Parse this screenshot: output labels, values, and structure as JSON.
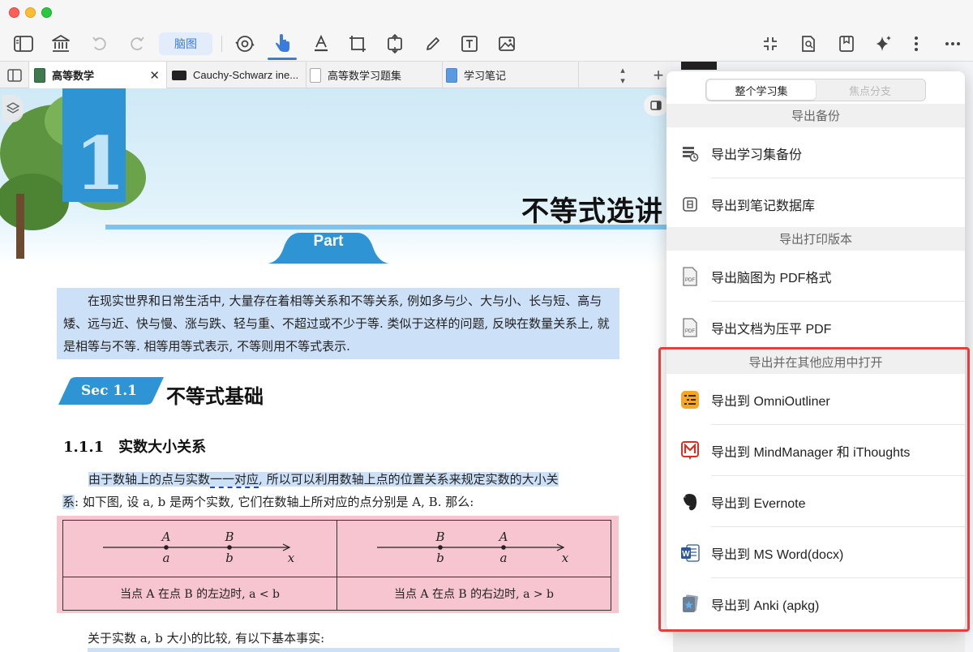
{
  "toolbar": {
    "mindmap_label": "脑图"
  },
  "tabs": [
    {
      "label": "高等数学",
      "active": true
    },
    {
      "label": "Cauchy-Schwarz ine..."
    },
    {
      "label": "高等数学习题集"
    },
    {
      "label": "学习笔记"
    }
  ],
  "document": {
    "chapter_number": "1",
    "chapter_title": "不等式选讲",
    "part_label": "Part",
    "intro_paragraph": "在现实世界和日常生活中, 大量存在着相等关系和不等关系, 例如多与少、大与小、长与短、高与矮、远与近、快与慢、涨与跌、轻与重、不超过或不少于等. 类似于这样的问题, 反映在数量关系上, 就是相等与不等. 相等用等式表示, 不等则用不等式表示.",
    "section_badge": "Sec 1.1",
    "section_title": "不等式基础",
    "subsection_title": "1.1.1　实数大小关系",
    "p2_part1": "由于数轴上的点与实数",
    "p2_dashed": "一一对应",
    "p2_part2": ", 所以可以利用数轴上点的位置关系来规定实数的大小关",
    "p2_line2_hl": "系",
    "p2_line2_rest": ": 如下图, 设 a, b 是两个实数, 它们在数轴上所对应的点分别是 A, B. 那么:",
    "figure": {
      "left": {
        "upper": [
          "A",
          "B"
        ],
        "lower": [
          "a",
          "b"
        ],
        "axis": "x",
        "caption": "当点 A 在点 B 的左边时, a < b"
      },
      "right": {
        "upper": [
          "B",
          "A"
        ],
        "lower": [
          "b",
          "a"
        ],
        "axis": "x",
        "caption": "当点 A 在点 B 的右边时, a > b"
      }
    },
    "p3": "关于实数 a, b 大小的比较, 有以下基本事实:"
  },
  "export_popover": {
    "segment": {
      "selected": "整个学习集",
      "unselected": "焦点分支"
    },
    "sections": [
      {
        "title": "导出备份",
        "items": [
          {
            "label": "导出学习集备份",
            "icon": "backup-icon"
          },
          {
            "label": "导出到笔记数据库",
            "icon": "database-icon"
          }
        ]
      },
      {
        "title": "导出打印版本",
        "items": [
          {
            "label": "导出脑图为 PDF格式",
            "icon": "pdf-icon"
          },
          {
            "label": "导出文档为压平 PDF",
            "icon": "pdf-icon"
          }
        ]
      },
      {
        "title": "导出并在其他应用中打开",
        "items": [
          {
            "label": "导出到 OmniOutliner",
            "icon": "omnioutliner-icon"
          },
          {
            "label": "导出到 MindManager 和 iThoughts",
            "icon": "mindmanager-icon"
          },
          {
            "label": "导出到 Evernote",
            "icon": "evernote-icon"
          },
          {
            "label": "导出到 MS Word(docx)",
            "icon": "word-icon"
          },
          {
            "label": "导出到 Anki (apkg)",
            "icon": "anki-icon"
          }
        ]
      }
    ]
  },
  "colors": {
    "accent": "#3a7bde",
    "highlight_blue": "#cce0f7",
    "highlight_pink": "#f6c5cf",
    "annotation_red": "#e04040"
  }
}
